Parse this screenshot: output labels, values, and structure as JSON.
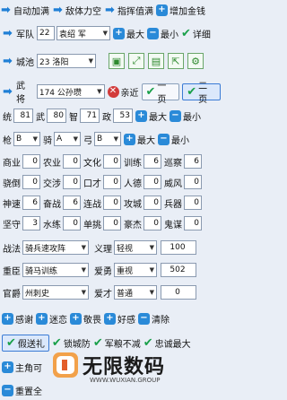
{
  "row1": [
    "自动加满",
    "敌体力空",
    "指挥值满",
    "增加金钱"
  ],
  "army": {
    "label": "军队",
    "id": "22",
    "name": "袁绍",
    "tag": "军",
    "max": "最大",
    "min": "最小",
    "detail": "详细"
  },
  "city": {
    "label": "城池",
    "id": "23",
    "name": "洛阳"
  },
  "general": {
    "label": "武将",
    "id": "174",
    "name": "公孙瓒",
    "near": "亲近",
    "one": "一页",
    "two": "二页"
  },
  "stats1": {
    "items": [
      {
        "k": "统",
        "v": "81"
      },
      {
        "k": "武",
        "v": "80"
      },
      {
        "k": "智",
        "v": "71"
      },
      {
        "k": "政",
        "v": "53"
      }
    ],
    "max": "最大",
    "min": "最小"
  },
  "stats2": {
    "items": [
      {
        "k": "枪",
        "v": "B"
      },
      {
        "k": "骑",
        "v": "A"
      },
      {
        "k": "弓",
        "v": "B"
      }
    ],
    "max": "最大",
    "min": "最小"
  },
  "skills": [
    [
      {
        "k": "商业",
        "v": "0"
      },
      {
        "k": "农业",
        "v": "0"
      },
      {
        "k": "文化",
        "v": "0"
      },
      {
        "k": "训练",
        "v": "6"
      },
      {
        "k": "巡察",
        "v": "6"
      }
    ],
    [
      {
        "k": "骁倒",
        "v": "0"
      },
      {
        "k": "交涉",
        "v": "0"
      },
      {
        "k": "口才",
        "v": "0"
      },
      {
        "k": "人德",
        "v": "0"
      },
      {
        "k": "威风",
        "v": "0"
      }
    ],
    [
      {
        "k": "神速",
        "v": "6"
      },
      {
        "k": "奋战",
        "v": "6"
      },
      {
        "k": "连战",
        "v": "0"
      },
      {
        "k": "攻城",
        "v": "0"
      },
      {
        "k": "兵器",
        "v": "0"
      }
    ],
    [
      {
        "k": "坚守",
        "v": "3"
      },
      {
        "k": "水练",
        "v": "0"
      },
      {
        "k": "单挑",
        "v": "0"
      },
      {
        "k": "豪杰",
        "v": "0"
      },
      {
        "k": "鬼谋",
        "v": "0"
      }
    ]
  ],
  "tactic": {
    "label": "战法",
    "value": "骑兵速攻阵",
    "rel_label": "义理",
    "rel_value": "轻视",
    "num": "100"
  },
  "shield": {
    "label": "重臣",
    "value": "骑马训练",
    "rel_label": "爱勇",
    "rel_value": "重视",
    "num": "502"
  },
  "office": {
    "label": "官爵",
    "value": "州刺史",
    "rel_label": "爱才",
    "rel_value": "普通",
    "num": "0"
  },
  "actions1": [
    "感谢",
    "迷恋",
    "敬畏",
    "好感",
    "清除"
  ],
  "actions2": [
    "假送礼",
    "锁城防",
    "军粮不减",
    "忠诚最大"
  ],
  "actions3": [
    "主角可"
  ],
  "actions4": [
    "重置全"
  ],
  "logo": {
    "text": "无限数码",
    "sub": "WWW.WUXIAN.GROUP"
  },
  "colors": {
    "accent": "#2a8ad8",
    "bg": "#e9eef6",
    "check": "#1aa04a"
  }
}
